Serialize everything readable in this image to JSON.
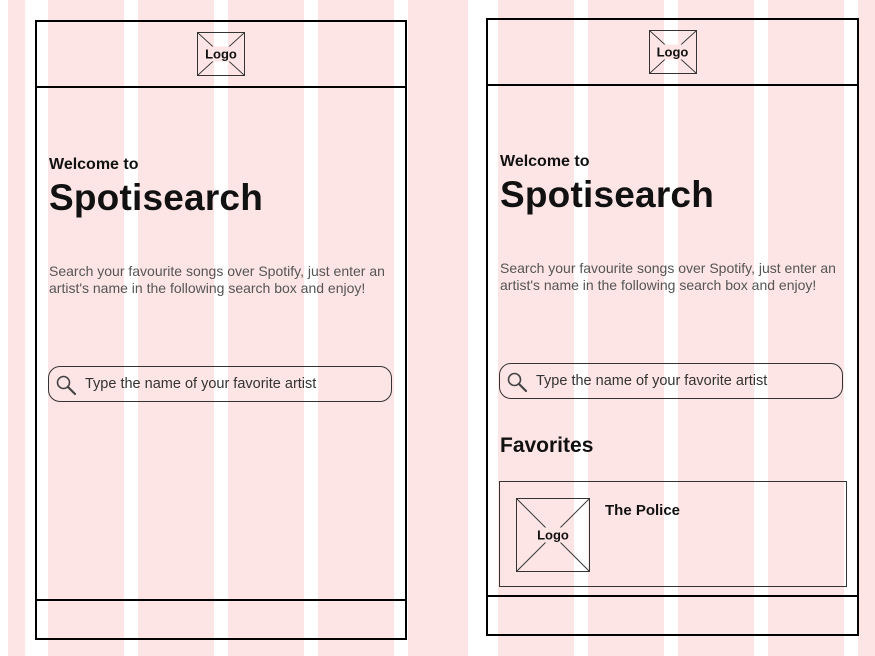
{
  "screens": [
    {
      "header_logo": "Logo",
      "welcome": "Welcome to",
      "brand": "Spotisearch",
      "description": "Search your favourite songs over Spotify, just enter an artist's name in the following search box and enjoy!",
      "search_placeholder": "Type the name of your favorite artist"
    },
    {
      "header_logo": "Logo",
      "welcome": "Welcome to",
      "brand": "Spotisearch",
      "description": "Search your favourite songs over Spotify, just enter an artist's name in the following search box and enjoy!",
      "search_placeholder": "Type the name of your favorite artist",
      "favorites": {
        "heading": "Favorites",
        "items": [
          {
            "logo": "Logo",
            "name": "The Police"
          }
        ]
      }
    }
  ],
  "colors": {
    "grid_column": "#fde5e5",
    "border": "#000000",
    "description_text": "#555555"
  }
}
